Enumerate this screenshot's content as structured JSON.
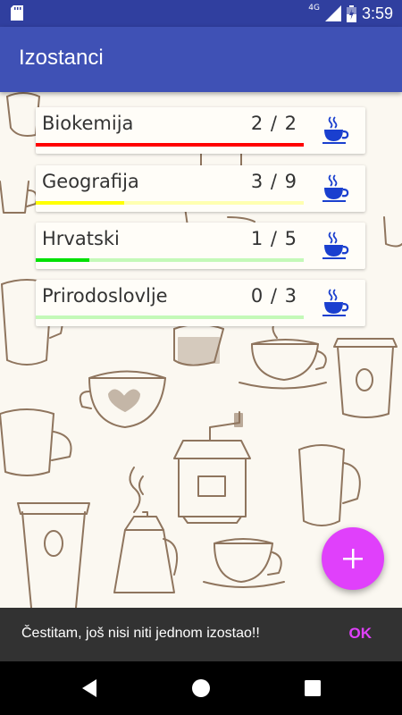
{
  "status_bar": {
    "network": "4G",
    "time": "3:59",
    "icons": [
      "sd-card-icon",
      "signal-icon",
      "battery-icon"
    ]
  },
  "app_bar": {
    "title": "Izostanci"
  },
  "subjects": [
    {
      "name": "Biokemija",
      "count": "2 / 2",
      "progress": 1.0,
      "fill_color": "#ff0000",
      "track_color": "#ff0000"
    },
    {
      "name": "Geografija",
      "count": "3 / 9",
      "progress": 0.33,
      "fill_color": "#ffff00",
      "track_color": "#ffffb0"
    },
    {
      "name": "Hrvatski",
      "count": "1 / 5",
      "progress": 0.2,
      "fill_color": "#00e000",
      "track_color": "#c4f9b8"
    },
    {
      "name": "Prirodoslovlje",
      "count": "0 / 3",
      "progress": 0.0,
      "fill_color": "#00e000",
      "track_color": "#c4f9b8"
    }
  ],
  "subject_action_icon": "coffee-cup-icon",
  "fab": {
    "icon": "plus-icon",
    "color": "#e040fb"
  },
  "snackbar": {
    "message": "Čestitam, još nisi niti jednom izostao!!",
    "action": "OK"
  },
  "colors": {
    "status_bar": "#303f9f",
    "primary": "#3f51b5",
    "accent": "#e040fb",
    "cup_blue": "#1a3fcf"
  }
}
